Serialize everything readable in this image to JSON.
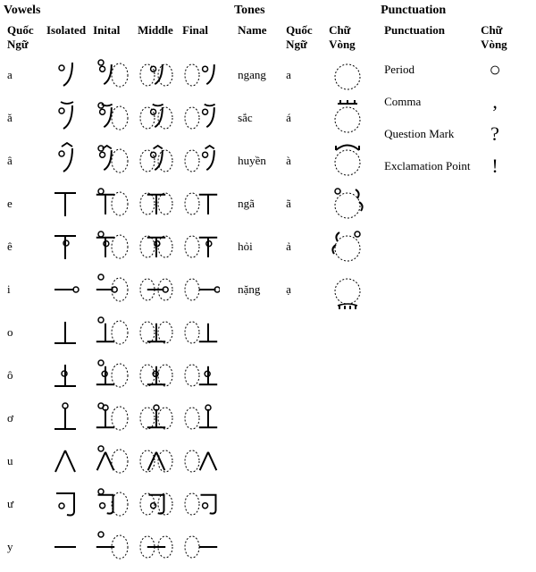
{
  "vowels": {
    "title": "Vowels",
    "headers": [
      "Quốc Ngữ",
      "Isolated",
      "Inital",
      "Middle",
      "Final"
    ],
    "rows": [
      {
        "qn": "a"
      },
      {
        "qn": "ă"
      },
      {
        "qn": "â"
      },
      {
        "qn": "e"
      },
      {
        "qn": "ê"
      },
      {
        "qn": "i"
      },
      {
        "qn": "o"
      },
      {
        "qn": "ô"
      },
      {
        "qn": "ơ"
      },
      {
        "qn": "u"
      },
      {
        "qn": "ư"
      },
      {
        "qn": "y"
      }
    ]
  },
  "tones": {
    "title": "Tones",
    "headers": [
      "Name",
      "Quốc Ngữ",
      "Chữ Vòng"
    ],
    "rows": [
      {
        "name": "ngang",
        "qn": "a"
      },
      {
        "name": "sắc",
        "qn": "á"
      },
      {
        "name": "huyền",
        "qn": "à"
      },
      {
        "name": "ngã",
        "qn": "ã"
      },
      {
        "name": "hỏi",
        "qn": "ả"
      },
      {
        "name": "nặng",
        "qn": "ạ"
      }
    ]
  },
  "punctuation": {
    "title": "Punctuation",
    "headers": [
      "Punctuation",
      "Chữ Vòng"
    ],
    "rows": [
      {
        "name": "Period",
        "glyph": "○"
      },
      {
        "name": "Comma",
        "glyph": ","
      },
      {
        "name": "Question Mark",
        "glyph": "?"
      },
      {
        "name": "Exclamation Point",
        "glyph": "!"
      }
    ]
  }
}
